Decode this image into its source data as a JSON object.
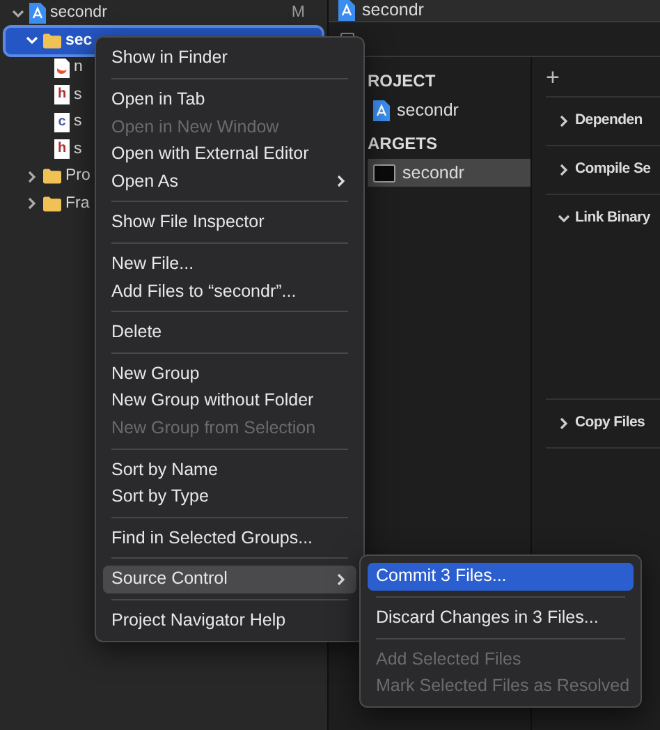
{
  "navigator": {
    "items": [
      {
        "label": "secondr",
        "kind": "project",
        "badge": "M",
        "expanded": true,
        "selected": false,
        "children": [
          {
            "label": "sec",
            "kind": "folder",
            "expanded": true,
            "selected": true,
            "children": [
              {
                "label": "n",
                "kind": "swift",
                "selected": false
              },
              {
                "label": "s",
                "kind": "file",
                "icon_letter": "h",
                "selected": false
              },
              {
                "label": "s",
                "kind": "file",
                "icon_letter": "c",
                "selected": false
              },
              {
                "label": "s",
                "kind": "file",
                "icon_letter": "h",
                "selected": false
              }
            ]
          },
          {
            "label": "Pro",
            "kind": "folder",
            "expanded": false,
            "selected": false
          },
          {
            "label": "Fra",
            "kind": "folder",
            "expanded": false,
            "selected": false
          }
        ]
      }
    ]
  },
  "editor": {
    "title": "secondr",
    "sections": [
      {
        "heading": "ROJECT",
        "items": [
          {
            "label": "secondr",
            "kind": "project",
            "selected": false
          }
        ]
      },
      {
        "heading": "ARGETS",
        "items": [
          {
            "label": "secondr",
            "kind": "target",
            "selected": true
          }
        ]
      }
    ],
    "add_button": "+",
    "phases": [
      {
        "label": "Dependen",
        "expanded": false
      },
      {
        "label": "Compile Se",
        "expanded": false
      },
      {
        "label": "Link Binary",
        "expanded": true
      },
      {
        "label": "Copy Files",
        "expanded": false
      }
    ]
  },
  "context_menu": {
    "sections": [
      [
        {
          "label": "Show in Finder",
          "disabled": false,
          "selected": false,
          "submenu": false
        }
      ],
      [
        {
          "label": "Open in Tab",
          "disabled": false,
          "selected": false,
          "submenu": false
        },
        {
          "label": "Open in New Window",
          "disabled": true,
          "selected": false,
          "submenu": false
        },
        {
          "label": "Open with External Editor",
          "disabled": false,
          "selected": false,
          "submenu": false
        },
        {
          "label": "Open As",
          "disabled": false,
          "selected": false,
          "submenu": true
        }
      ],
      [
        {
          "label": "Show File Inspector",
          "disabled": false,
          "selected": false,
          "submenu": false
        }
      ],
      [
        {
          "label": "New File...",
          "disabled": false,
          "selected": false,
          "submenu": false
        },
        {
          "label": "Add Files to “secondr”...",
          "disabled": false,
          "selected": false,
          "submenu": false
        }
      ],
      [
        {
          "label": "Delete",
          "disabled": false,
          "selected": false,
          "submenu": false
        }
      ],
      [
        {
          "label": "New Group",
          "disabled": false,
          "selected": false,
          "submenu": false
        },
        {
          "label": "New Group without Folder",
          "disabled": false,
          "selected": false,
          "submenu": false
        },
        {
          "label": "New Group from Selection",
          "disabled": true,
          "selected": false,
          "submenu": false
        }
      ],
      [
        {
          "label": "Sort by Name",
          "disabled": false,
          "selected": false,
          "submenu": false
        },
        {
          "label": "Sort by Type",
          "disabled": false,
          "selected": false,
          "submenu": false
        }
      ],
      [
        {
          "label": "Find in Selected Groups...",
          "disabled": false,
          "selected": false,
          "submenu": false
        }
      ],
      [
        {
          "label": "Source Control",
          "disabled": false,
          "selected": true,
          "submenu": true
        }
      ],
      [
        {
          "label": "Project Navigator Help",
          "disabled": false,
          "selected": false,
          "submenu": false
        }
      ]
    ]
  },
  "submenu": {
    "sections": [
      [
        {
          "label": "Commit 3 Files...",
          "disabled": false,
          "selected": true
        }
      ],
      [
        {
          "label": "Discard Changes in 3 Files...",
          "disabled": false,
          "selected": false
        }
      ],
      [
        {
          "label": "Add Selected Files",
          "disabled": true,
          "selected": false
        },
        {
          "label": "Mark Selected Files as Resolved",
          "disabled": true,
          "selected": false
        }
      ]
    ]
  }
}
